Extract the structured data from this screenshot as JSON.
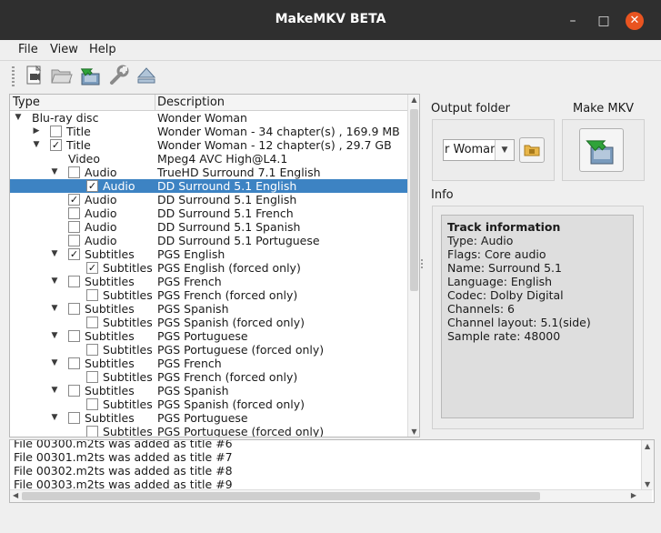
{
  "window": {
    "title": "MakeMKV BETA",
    "minimize": "–",
    "maximize": "□",
    "close": "✕"
  },
  "menu": [
    "File",
    "View",
    "Help"
  ],
  "toolbar": {
    "icons": [
      "open-files-icon",
      "open-disc-folder-icon",
      "backup-icon",
      "settings-wrench-icon",
      "eject-icon"
    ]
  },
  "tree": {
    "columns": {
      "type": "Type",
      "description": "Description"
    },
    "rows": [
      {
        "arrow": "▼",
        "checkbox": null,
        "label": "Blu-ray disc",
        "desc": "Wonder Woman",
        "indent": 0,
        "selected": false
      },
      {
        "arrow": "▶",
        "checkbox": "",
        "label": "Title",
        "desc": "Wonder Woman - 34 chapter(s) , 169.9 MB",
        "indent": 1,
        "selected": false
      },
      {
        "arrow": "▼",
        "checkbox": "✓",
        "label": "Title",
        "desc": "Wonder Woman - 12 chapter(s) , 29.7 GB",
        "indent": 1,
        "selected": false
      },
      {
        "arrow": "",
        "checkbox": null,
        "label": "Video",
        "desc": "Mpeg4 AVC High@L4.1",
        "indent": 2,
        "selected": false
      },
      {
        "arrow": "▼",
        "checkbox": "",
        "label": "Audio",
        "desc": "TrueHD Surround 7.1 English",
        "indent": 2,
        "selected": false
      },
      {
        "arrow": "",
        "checkbox": "✓",
        "label": "Audio",
        "desc": "DD Surround 5.1 English",
        "indent": 3,
        "selected": true
      },
      {
        "arrow": "",
        "checkbox": "✓",
        "label": "Audio",
        "desc": "DD Surround 5.1 English",
        "indent": 2,
        "selected": false
      },
      {
        "arrow": "",
        "checkbox": "",
        "label": "Audio",
        "desc": "DD Surround 5.1 French",
        "indent": 2,
        "selected": false
      },
      {
        "arrow": "",
        "checkbox": "",
        "label": "Audio",
        "desc": "DD Surround 5.1 Spanish",
        "indent": 2,
        "selected": false
      },
      {
        "arrow": "",
        "checkbox": "",
        "label": "Audio",
        "desc": "DD Surround 5.1 Portuguese",
        "indent": 2,
        "selected": false
      },
      {
        "arrow": "▼",
        "checkbox": "✓",
        "label": "Subtitles",
        "desc": "PGS English",
        "indent": 2,
        "selected": false
      },
      {
        "arrow": "",
        "checkbox": "✓",
        "label": "Subtitles",
        "desc": "PGS English  (forced only)",
        "indent": 3,
        "selected": false
      },
      {
        "arrow": "▼",
        "checkbox": "",
        "label": "Subtitles",
        "desc": "PGS French",
        "indent": 2,
        "selected": false
      },
      {
        "arrow": "",
        "checkbox": "",
        "label": "Subtitles",
        "desc": "PGS French  (forced only)",
        "indent": 3,
        "selected": false
      },
      {
        "arrow": "▼",
        "checkbox": "",
        "label": "Subtitles",
        "desc": "PGS Spanish",
        "indent": 2,
        "selected": false
      },
      {
        "arrow": "",
        "checkbox": "",
        "label": "Subtitles",
        "desc": "PGS Spanish  (forced only)",
        "indent": 3,
        "selected": false
      },
      {
        "arrow": "▼",
        "checkbox": "",
        "label": "Subtitles",
        "desc": "PGS Portuguese",
        "indent": 2,
        "selected": false
      },
      {
        "arrow": "",
        "checkbox": "",
        "label": "Subtitles",
        "desc": "PGS Portuguese  (forced only)",
        "indent": 3,
        "selected": false
      },
      {
        "arrow": "▼",
        "checkbox": "",
        "label": "Subtitles",
        "desc": "PGS French",
        "indent": 2,
        "selected": false
      },
      {
        "arrow": "",
        "checkbox": "",
        "label": "Subtitles",
        "desc": "PGS French  (forced only)",
        "indent": 3,
        "selected": false
      },
      {
        "arrow": "▼",
        "checkbox": "",
        "label": "Subtitles",
        "desc": "PGS Spanish",
        "indent": 2,
        "selected": false
      },
      {
        "arrow": "",
        "checkbox": "",
        "label": "Subtitles",
        "desc": "PGS Spanish  (forced only)",
        "indent": 3,
        "selected": false
      },
      {
        "arrow": "▼",
        "checkbox": "",
        "label": "Subtitles",
        "desc": "PGS Portuguese",
        "indent": 2,
        "selected": false
      },
      {
        "arrow": "",
        "checkbox": "",
        "label": "Subtitles",
        "desc": "PGS Portuguese  (forced only)",
        "indent": 3,
        "selected": false
      }
    ]
  },
  "output": {
    "label": "Output folder",
    "value": "r Woman",
    "make_label": "Make MKV"
  },
  "info": {
    "label": "Info",
    "lines": [
      "Track information",
      "Type: Audio",
      "Flags: Core audio",
      "Name: Surround 5.1",
      "Language: English",
      "Codec: Dolby Digital",
      "Channels: 6",
      "Channel layout: 5.1(side)",
      "Sample rate: 48000"
    ]
  },
  "log": {
    "lines": [
      "File 00300.m2ts was added as title #6",
      "File 00301.m2ts was added as title #7",
      "File 00302.m2ts was added as title #8",
      "File 00303.m2ts was added as title #9"
    ]
  },
  "colors": {
    "selection": "#3d83c3",
    "titlebar": "#2f2f2f",
    "close": "#e95420"
  }
}
